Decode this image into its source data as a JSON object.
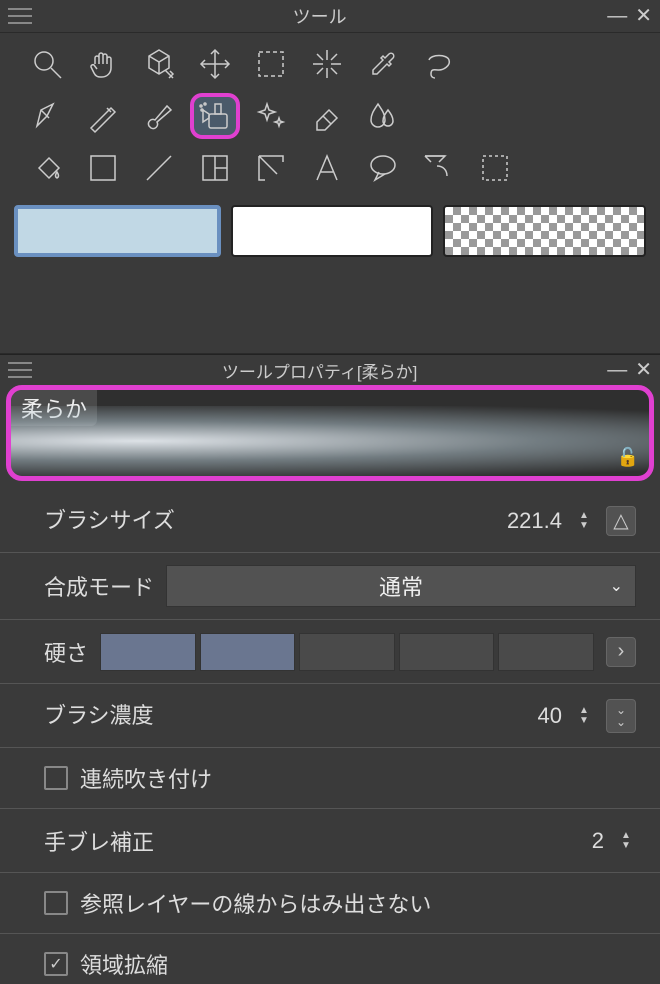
{
  "tools": {
    "title": "ツール"
  },
  "props": {
    "title": "ツールプロパティ[柔らか]",
    "preview_label": "柔らか",
    "rows": {
      "brush_size": {
        "label": "ブラシサイズ",
        "value": "221.4",
        "fill_pct": 55
      },
      "blend_mode": {
        "label": "合成モード",
        "value": "通常"
      },
      "hardness": {
        "label": "硬さ",
        "active_segments": 2,
        "total_segments": 5
      },
      "density": {
        "label": "ブラシ濃度",
        "value": "40",
        "fill_pct": 34
      },
      "continuous": {
        "label": "連続吹き付け",
        "checked": false
      },
      "stabilize": {
        "label": "手ブレ補正",
        "value": "2"
      },
      "ref_layer": {
        "label": "参照レイヤーの線からはみ出さない",
        "checked": false
      },
      "expand": {
        "label": "領域拡縮",
        "checked": true
      }
    }
  }
}
